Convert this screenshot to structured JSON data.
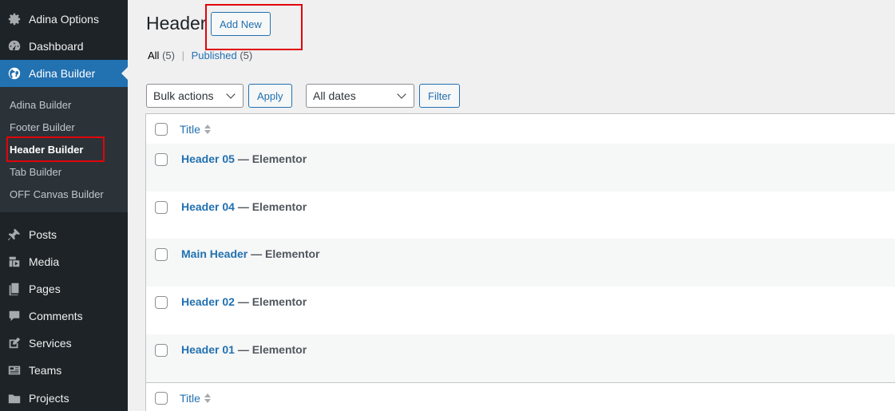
{
  "sidebar": {
    "items": [
      {
        "label": "Adina Options",
        "icon": "gear-icon"
      },
      {
        "label": "Dashboard",
        "icon": "dashboard-icon"
      },
      {
        "label": "Adina Builder",
        "icon": "globe-icon"
      },
      {
        "label": "Posts",
        "icon": "pushpin-icon"
      },
      {
        "label": "Media",
        "icon": "media-icon"
      },
      {
        "label": "Pages",
        "icon": "pages-icon"
      },
      {
        "label": "Comments",
        "icon": "comment-icon"
      },
      {
        "label": "Services",
        "icon": "edit-icon"
      },
      {
        "label": "Teams",
        "icon": "id-card-icon"
      },
      {
        "label": "Projects",
        "icon": "folder-icon"
      }
    ],
    "submenu": [
      "Adina Builder",
      "Footer Builder",
      "Header Builder",
      "Tab Builder",
      "OFF Canvas Builder"
    ]
  },
  "page": {
    "title": "Header",
    "add_new_label": "Add New"
  },
  "filters": {
    "all_label": "All",
    "all_count": "(5)",
    "separator": "|",
    "published_label": "Published",
    "published_count": "(5)",
    "bulk_actions": "Bulk actions",
    "apply_label": "Apply",
    "dates": "All dates",
    "filter_label": "Filter"
  },
  "table": {
    "column_title": "Title",
    "rows": [
      {
        "title": "Header 05",
        "state": "— Elementor"
      },
      {
        "title": "Header 04",
        "state": "— Elementor"
      },
      {
        "title": "Main Header",
        "state": "— Elementor"
      },
      {
        "title": "Header 02",
        "state": "— Elementor"
      },
      {
        "title": "Header 01",
        "state": "— Elementor"
      }
    ]
  },
  "colors": {
    "sidebar_bg": "#1d2327",
    "submenu_bg": "#2c3338",
    "accent": "#2271b1",
    "highlight_box": "#e1040a"
  }
}
